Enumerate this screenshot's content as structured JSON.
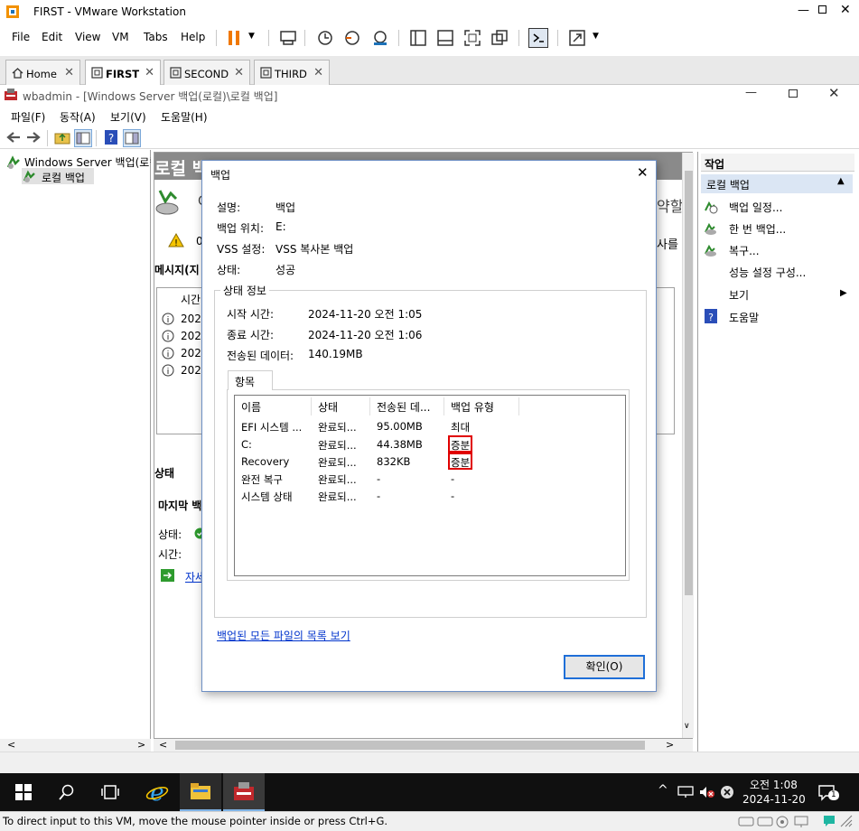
{
  "vm": {
    "window_title": "FIRST - VMware Workstation",
    "menu": [
      "File",
      "Edit",
      "View",
      "VM",
      "Tabs",
      "Help"
    ],
    "tabs": [
      {
        "label": "Home",
        "active": false
      },
      {
        "label": "FIRST",
        "active": true
      },
      {
        "label": "SECOND",
        "active": false
      },
      {
        "label": "THIRD",
        "active": false
      }
    ],
    "status_hint": "To direct input to this VM, move the mouse pointer inside or press Ctrl+G."
  },
  "wbadmin": {
    "title": "wbadmin - [Windows Server 백업(로컬)\\로컬 백업]",
    "menu": [
      "파일(F)",
      "동작(A)",
      "보기(V)",
      "도움말(H)"
    ],
    "tree": {
      "root": "Windows Server 백업(로컬)",
      "child": "로컬 백업"
    },
    "center": {
      "header_text": "로컬 백",
      "right_frag_1": "약할",
      "right_frag_2": "사를",
      "row1_frag": "C",
      "warn_frag": "0",
      "messages_title": "메시지(지",
      "messages_col": "시간",
      "message_rows": [
        "2024",
        "2024",
        "2024",
        "2024"
      ],
      "status_title": "상태",
      "last_backup_label": "마지막 백",
      "status_label": "상태:",
      "time_label": "시간:",
      "details_link": "자세"
    },
    "actions": {
      "title": "작업",
      "section": "로컬 백업",
      "items": [
        "백업 일정...",
        "한 번 백업...",
        "복구...",
        "성능 설정 구성...",
        "보기",
        "도움말"
      ]
    }
  },
  "dialog": {
    "title": "백업",
    "fields": [
      {
        "label": "설명:",
        "value": "백업"
      },
      {
        "label": "백업 위치:",
        "value": "E:"
      },
      {
        "label": "VSS 설정:",
        "value": "VSS 복사본 백업"
      },
      {
        "label": "상태:",
        "value": "성공"
      }
    ],
    "status_group_title": "상태 정보",
    "status_fields": [
      {
        "label": "시작 시간:",
        "value": "2024-11-20 오전 1:05"
      },
      {
        "label": "종료 시간:",
        "value": "2024-11-20 오전 1:06"
      },
      {
        "label": "전송된 데이터:",
        "value": "140.19MB"
      }
    ],
    "items_tab": "항목",
    "columns": [
      "이름",
      "상태",
      "전송된 데...",
      "백업 유형"
    ],
    "rows": [
      {
        "name": "EFI 시스템 ...",
        "status": "완료되...",
        "transferred": "95.00MB",
        "type": "최대"
      },
      {
        "name": "C:",
        "status": "완료되...",
        "transferred": "44.38MB",
        "type": "증분"
      },
      {
        "name": "Recovery",
        "status": "완료되...",
        "transferred": "832KB",
        "type": "증분"
      },
      {
        "name": "완전 복구",
        "status": "완료되...",
        "transferred": "-",
        "type": "-"
      },
      {
        "name": "시스템 상태",
        "status": "완료되...",
        "transferred": "-",
        "type": "-"
      }
    ],
    "link": "백업된 모든 파일의 목록 보기",
    "ok": "확인(O)"
  },
  "taskbar": {
    "time": "오전 1:08",
    "date": "2024-11-20",
    "notification_count": "1"
  },
  "colors": {
    "accent": "#1f6fd8",
    "highlight": "#e00000",
    "taskbar": "#101010",
    "link": "#0033cc"
  }
}
